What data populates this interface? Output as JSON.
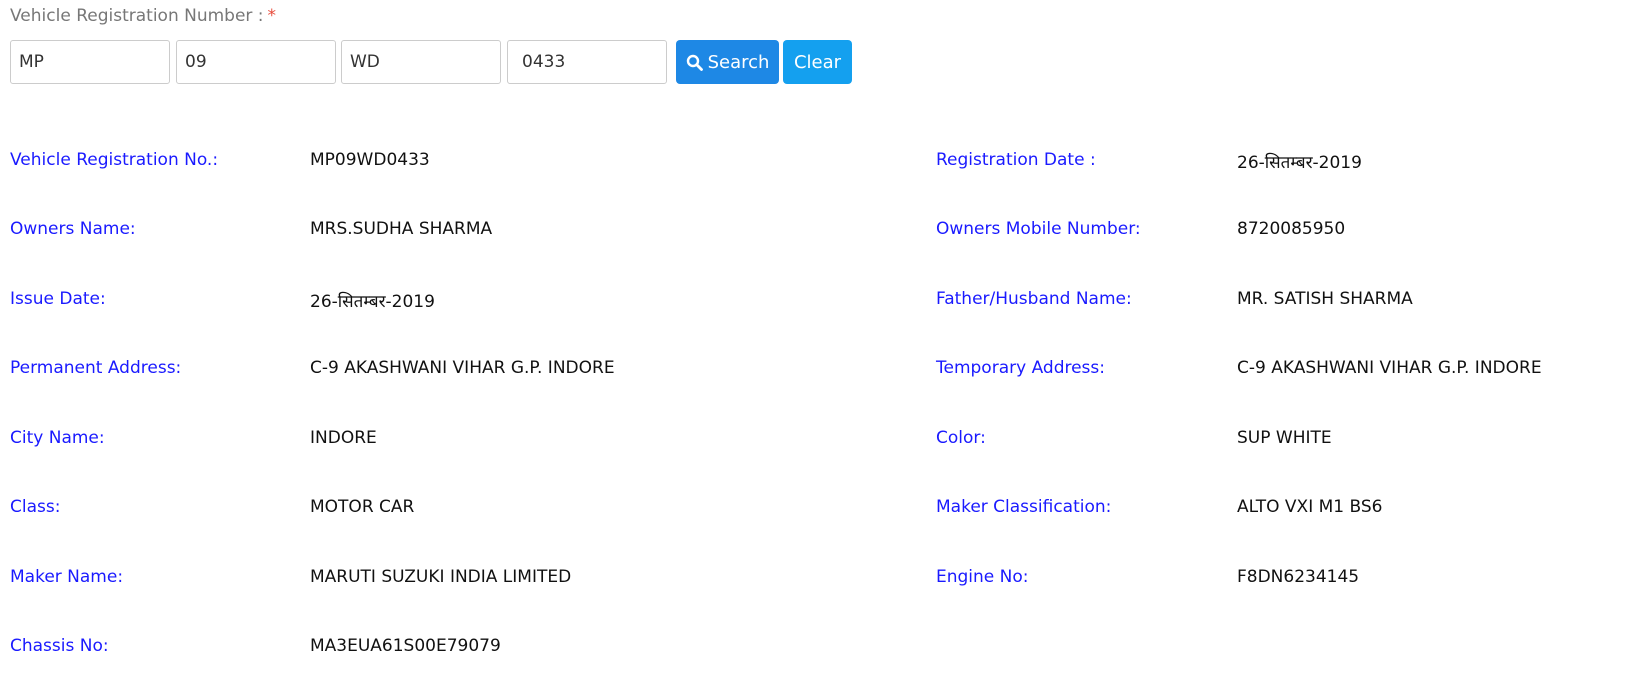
{
  "search": {
    "label": "Vehicle Registration Number :",
    "required_mark": "*",
    "parts": [
      "MP",
      "09",
      "WD",
      "0433"
    ],
    "search_label": "Search",
    "search_icon": "search-icon",
    "clear_label": "Clear",
    "accent": "#1e88e5"
  },
  "details": {
    "label_color": "#1a1aff",
    "rows": [
      {
        "left_label": "Vehicle Registration No.:",
        "left_value": "MP09WD0433",
        "right_label": "Registration Date :",
        "right_value": "26-सितम्बर-2019"
      },
      {
        "left_label": "Owners Name:",
        "left_value": "MRS.SUDHA SHARMA",
        "right_label": "Owners Mobile Number:",
        "right_value": "8720085950"
      },
      {
        "left_label": "Issue Date:",
        "left_value": "26-सितम्बर-2019",
        "right_label": "Father/Husband Name:",
        "right_value": "MR. SATISH SHARMA"
      },
      {
        "left_label": "Permanent Address:",
        "left_value": "C-9 AKASHWANI VIHAR G.P. INDORE",
        "right_label": "Temporary Address:",
        "right_value": "C-9 AKASHWANI VIHAR G.P. INDORE"
      },
      {
        "left_label": "City Name:",
        "left_value": "INDORE",
        "right_label": "Color:",
        "right_value": "SUP WHITE"
      },
      {
        "left_label": "Class:",
        "left_value": "MOTOR CAR",
        "right_label": "Maker Classification:",
        "right_value": "ALTO VXI M1 BS6"
      },
      {
        "left_label": "Maker Name:",
        "left_value": "MARUTI SUZUKI INDIA LIMITED",
        "right_label": "Engine No:",
        "right_value": "F8DN6234145"
      },
      {
        "left_label": "Chassis No:",
        "left_value": "MA3EUA61S00E79079"
      }
    ]
  }
}
